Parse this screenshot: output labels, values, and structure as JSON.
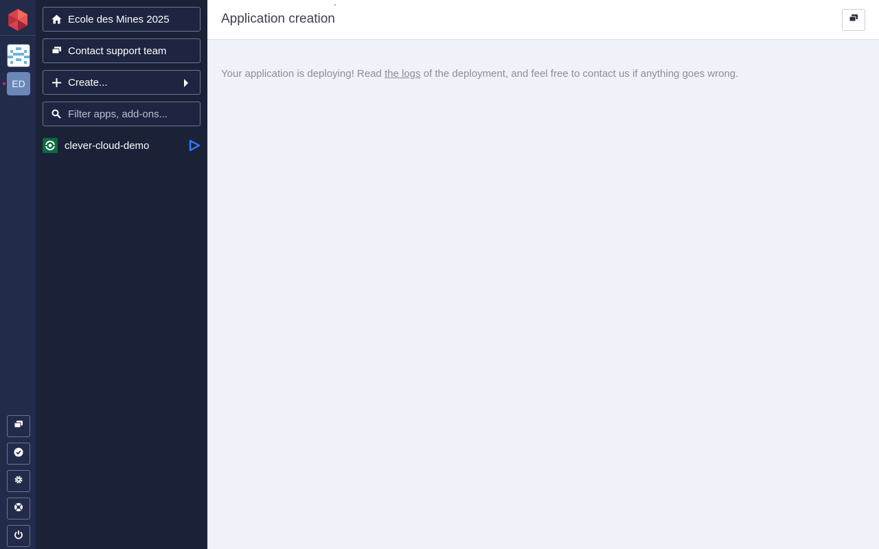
{
  "sidebar": {
    "org_name": "Ecole des Mines 2025",
    "support_label": "Contact support team",
    "create_label": "Create...",
    "search_placeholder": "Filter apps, add-ons...",
    "apps": [
      {
        "name": "clever-cloud-demo"
      }
    ]
  },
  "rail": {
    "org_initials": "ED"
  },
  "header": {
    "title": "Application creation",
    "tick": "-"
  },
  "main": {
    "message_before": "Your application is deploying! Read ",
    "message_link": "the logs",
    "message_after": " of the deployment, and feel free to contact us if anything goes wrong."
  },
  "colors": {
    "rail_bg": "#232b4b",
    "panel_bg": "#1b2137",
    "content_bg": "#eff2f8",
    "accent_blue": "#2b7fff",
    "app_green": "#0c6b3e",
    "brand_red": "#e0245e"
  }
}
